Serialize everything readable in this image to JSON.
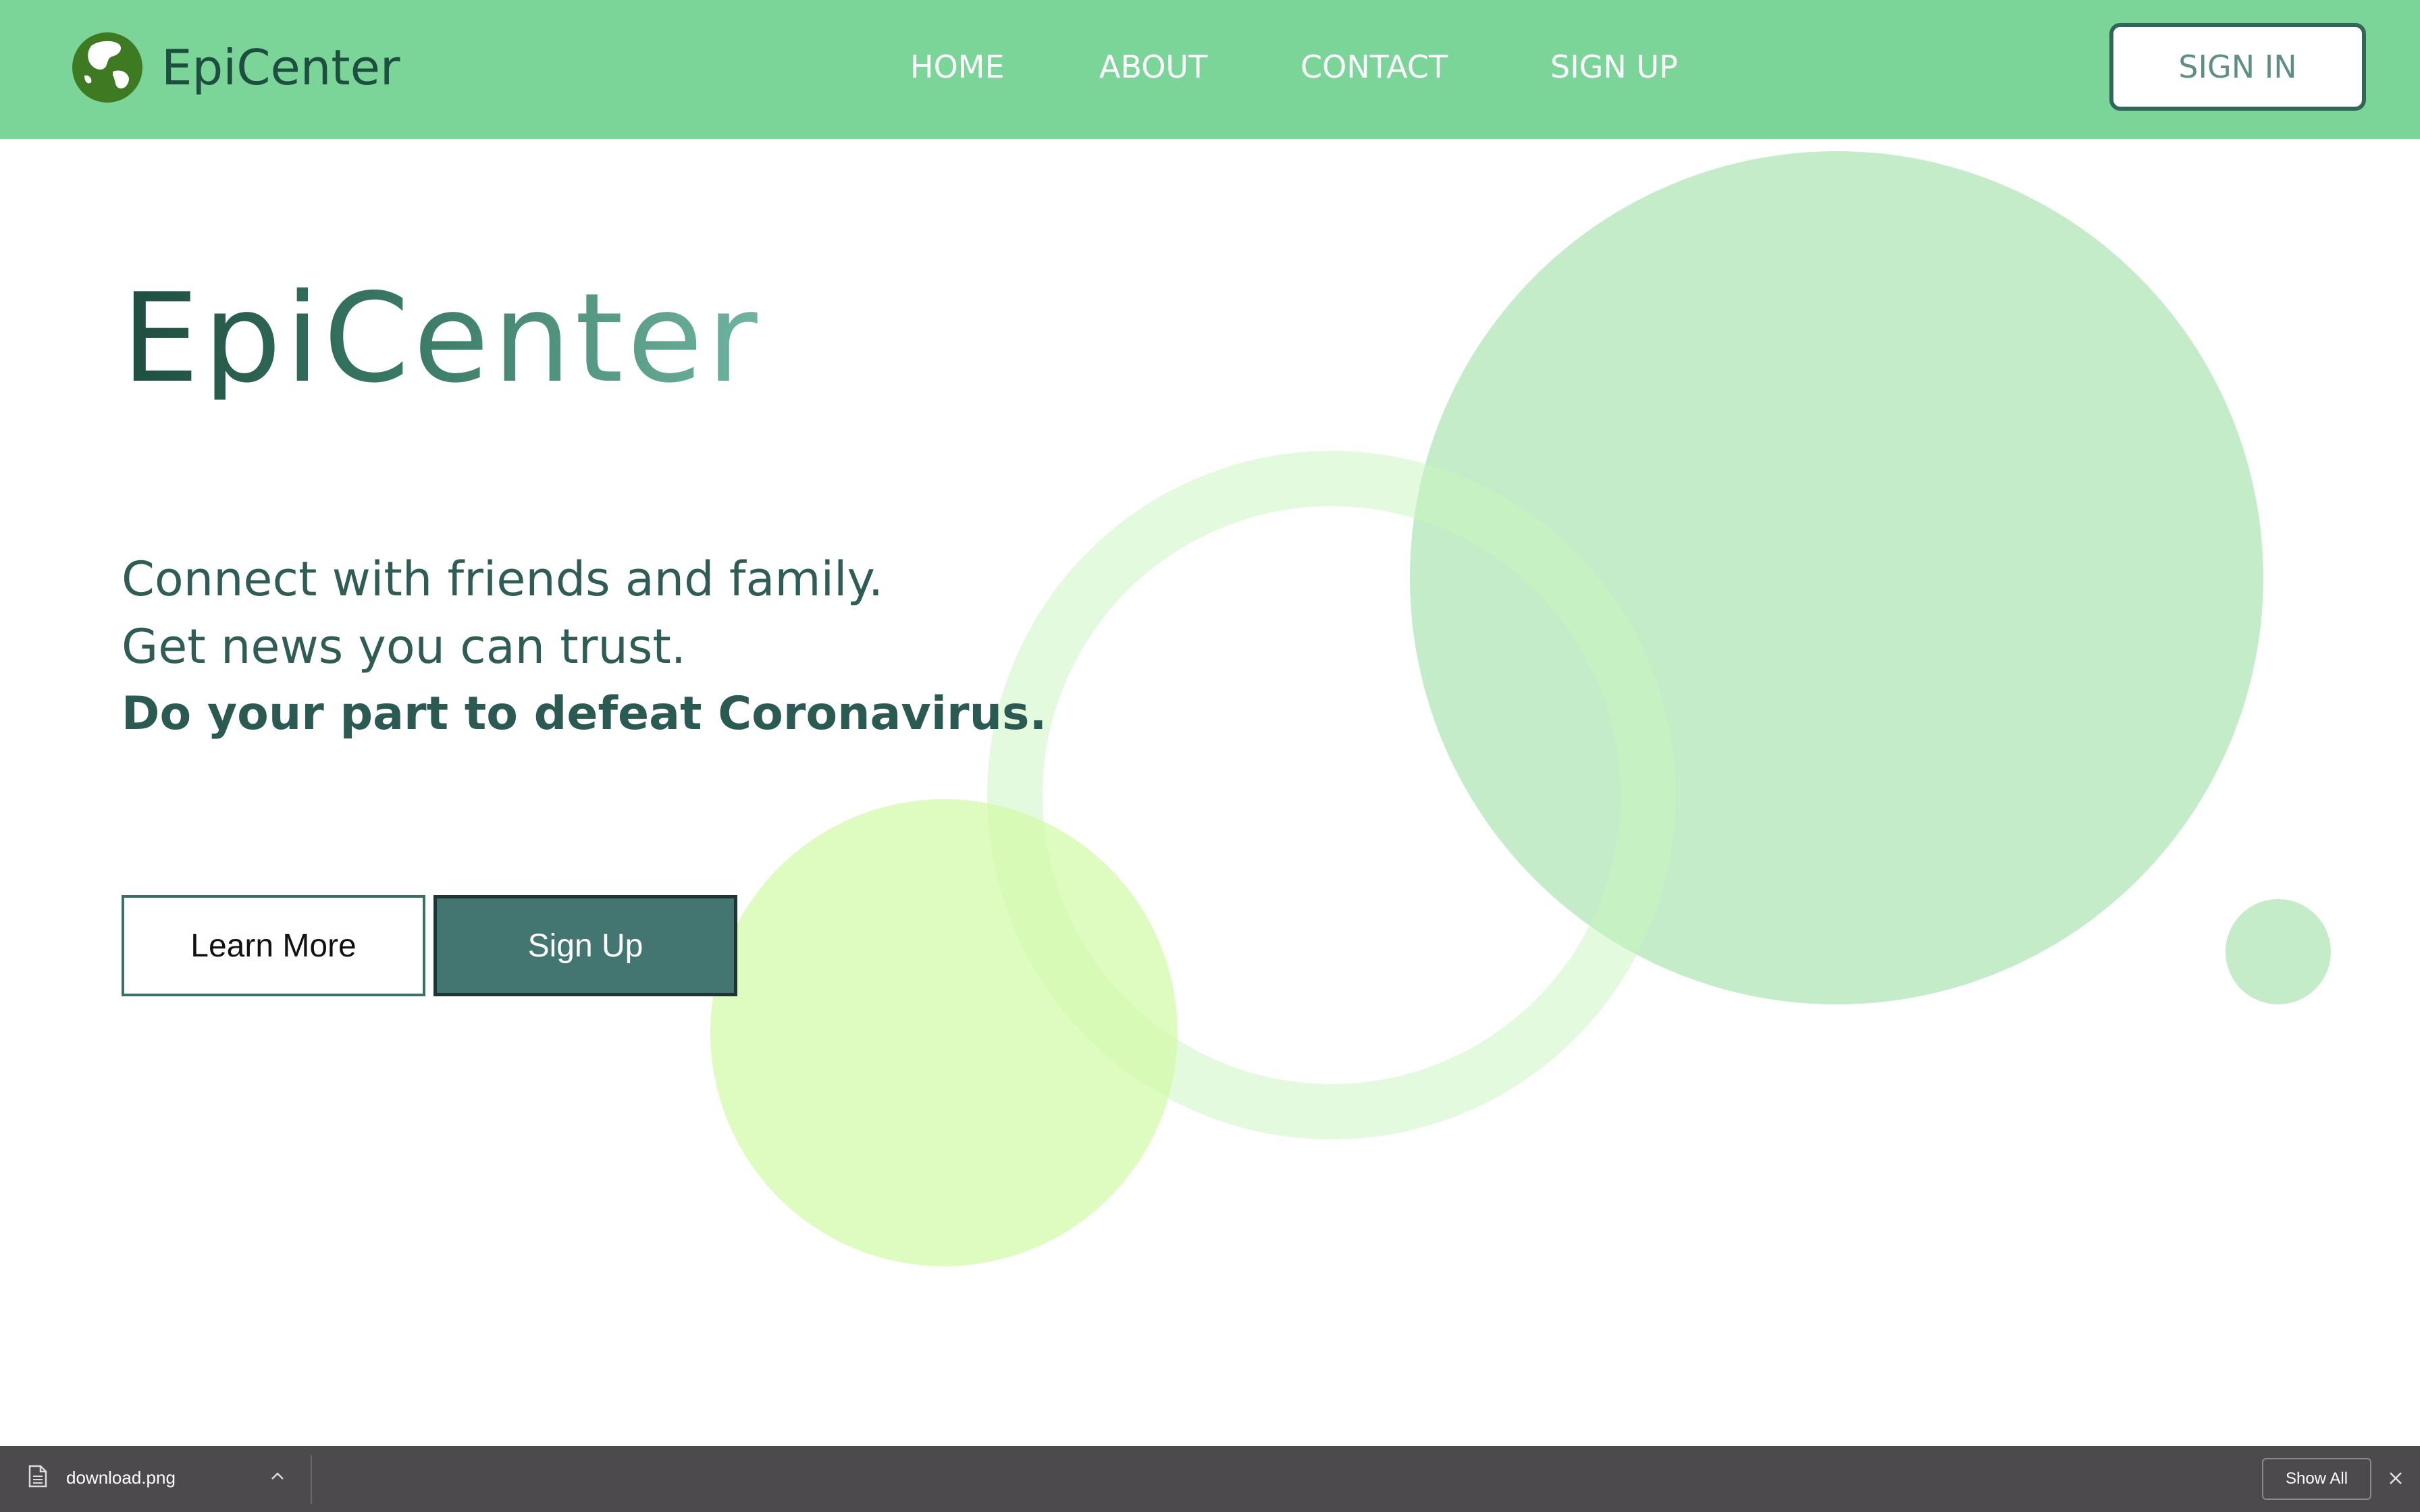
{
  "app": {
    "brand_name": "EpiCenter",
    "logo_icon": "globe-icon"
  },
  "nav": {
    "items": [
      "HOME",
      "ABOUT",
      "CONTACT",
      "SIGN UP"
    ],
    "sign_in_label": "SIGN IN"
  },
  "hero": {
    "title": "EpiCenter",
    "tagline_1": "Connect with friends and family.",
    "tagline_2": "Get news you can trust.",
    "tagline_3": "Do your part to defeat Coronavirus.",
    "learn_more_label": "Learn More",
    "sign_up_label": "Sign Up"
  },
  "download_bar": {
    "file_name": "download.png",
    "file_icon": "document-icon",
    "show_all_label": "Show All",
    "close_icon": "close-icon"
  },
  "colors": {
    "navbar": "#7bd498",
    "brand_dark": "#1e4e3f",
    "sign_up_button": "#437671",
    "circle_light_green": "#c4ecc9",
    "circle_lime": "#dffcb7",
    "ring_green": "#e3fbdc"
  }
}
